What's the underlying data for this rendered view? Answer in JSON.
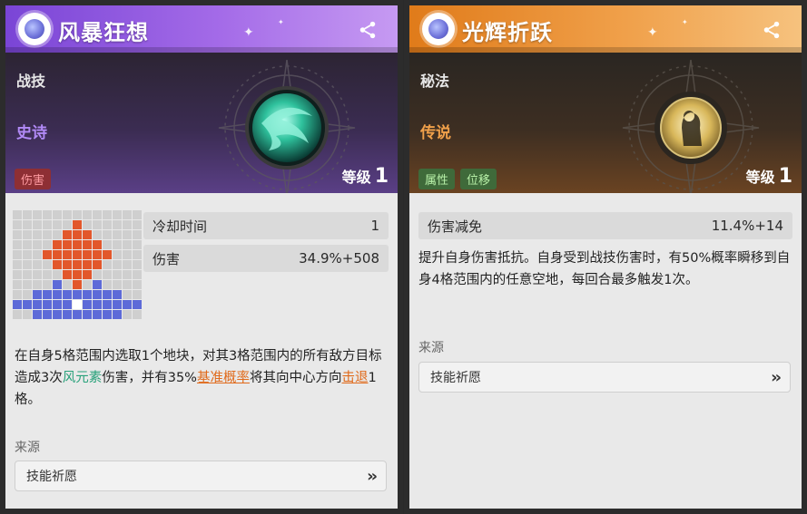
{
  "cards": [
    {
      "title": "风暴狂想",
      "type": "战技",
      "rarity": "史诗",
      "tags": [
        "伤害"
      ],
      "level_label": "等级",
      "level_value": "1",
      "stats": [
        {
          "label": "冷却时间",
          "value": "1"
        },
        {
          "label": "伤害",
          "value": "34.9%+508"
        }
      ],
      "description": {
        "p1": "在自身5格范围内选取1个地块，对其3格范围内的所有敌方目标造成3次",
        "hl1": "风元素",
        "p2": "伤害，并有35%",
        "hl2": "基准概率",
        "p3": "将其向中心方向",
        "hl3": "击退",
        "p4": "1格。"
      },
      "source_label": "来源",
      "source_button": "技能祈愿",
      "icon_name": "wind-vortex-icon"
    },
    {
      "title": "光辉折跃",
      "type": "秘法",
      "rarity": "传说",
      "tags": [
        "属性",
        "位移"
      ],
      "level_label": "等级",
      "level_value": "1",
      "stats": [
        {
          "label": "伤害减免",
          "value": "11.4%+14"
        }
      ],
      "description": "提升自身伤害抵抗。自身受到战技伤害时，有50%概率瞬移到自身4格范围内的任意空地，每回合最多触发1次。",
      "source_label": "来源",
      "source_button": "技能祈愿",
      "icon_name": "golden-figure-icon"
    }
  ],
  "colors": {
    "epic_purple": "#a46be8",
    "legend_orange": "#f0a04a",
    "tag_red": "#8e2f34",
    "tag_green": "#3f6a3a",
    "element_green": "#28a17a",
    "keyword_orange": "#e06a1b",
    "range_orange": "#e2572b",
    "range_blue": "#5d6ad8"
  }
}
